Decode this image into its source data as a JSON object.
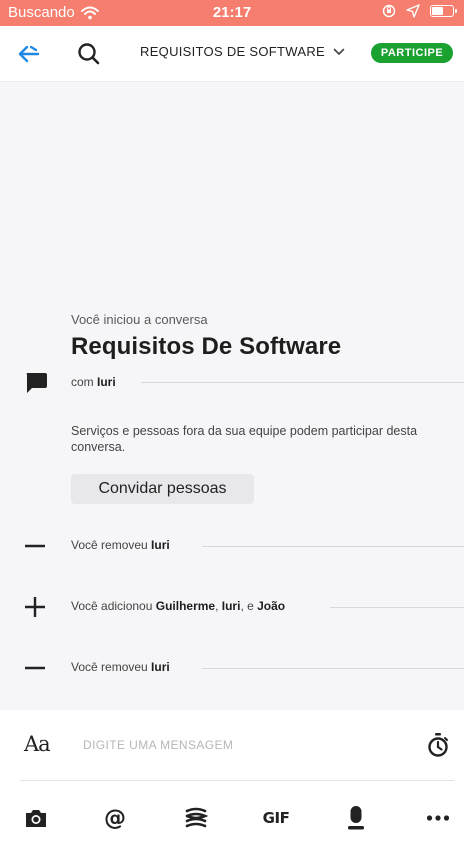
{
  "status_bar": {
    "carrier": "Buscando",
    "time": "21:17",
    "battery_level": 0.5
  },
  "header": {
    "conversation_title": "REQUISITOS DE SOFTWARE",
    "join_label": "PARTICIPE",
    "accent_color": "#1aa130"
  },
  "conversation": {
    "started_label": "Você iniciou a conversa",
    "title": "Requisitos De Software",
    "with_prefix": "com",
    "with_name": "Iuri",
    "notice": "Serviços e pessoas fora da sua equipe podem participar desta conversa.",
    "invite_label": "Convidar pessoas",
    "events": [
      {
        "icon": "minus-icon",
        "text": "Você removeu",
        "names": [
          "Iuri"
        ]
      },
      {
        "icon": "plus-icon",
        "text": "Você adicionou",
        "names": [
          "Guilherme",
          "Iuri",
          "João"
        ],
        "separator": ", ",
        "last_separator": ", e "
      },
      {
        "icon": "minus-icon",
        "text": "Você removeu",
        "names": [
          "Iuri"
        ]
      }
    ]
  },
  "composer": {
    "format_label": "Aa",
    "placeholder": "DIGITE UMA MENSAGEM",
    "toolbar": {
      "mention_label": "@",
      "gif_label": "GIF",
      "icons": [
        "camera-icon",
        "mention-icon",
        "giphy-icon",
        "gif-icon",
        "microphone-icon",
        "more-icon"
      ]
    }
  }
}
